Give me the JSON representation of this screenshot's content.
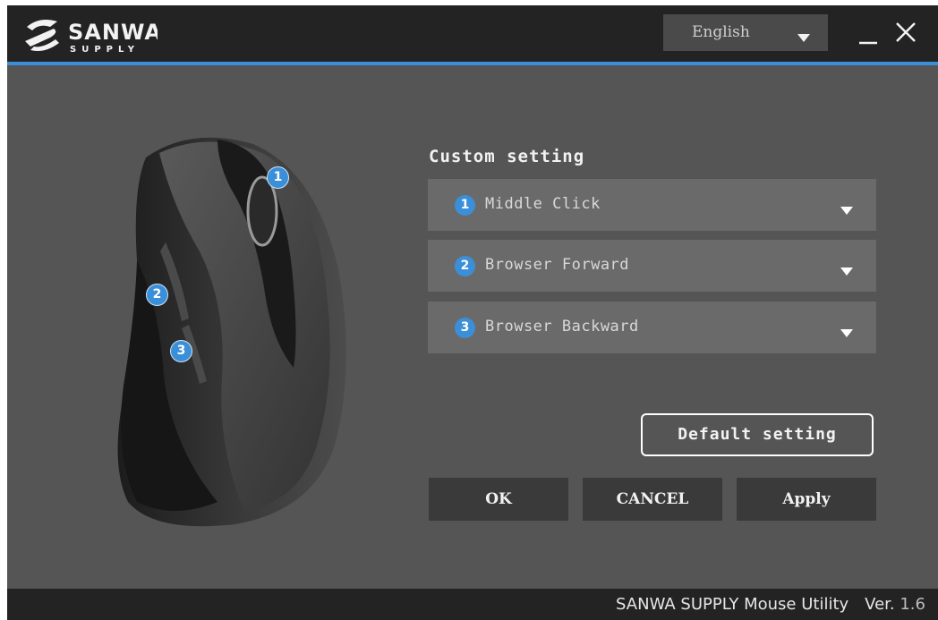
{
  "brand": {
    "logo_line1": "SANWA",
    "logo_line2": "SUPPLY"
  },
  "header": {
    "language": "English",
    "colors": {
      "titlebar": "#232323",
      "accent": "#3b8fd9"
    }
  },
  "main": {
    "section_title": "Custom setting",
    "buttons": [
      {
        "number": "1",
        "action": "Middle Click"
      },
      {
        "number": "2",
        "action": "Browser Forward"
      },
      {
        "number": "3",
        "action": "Browser Backward"
      }
    ],
    "default_label": "Default setting",
    "ok_label": "OK",
    "cancel_label": "CANCEL",
    "apply_label": "Apply"
  },
  "mouse_callouts": [
    "1",
    "2",
    "3"
  ],
  "footer": {
    "app_name": "SANWA SUPPLY Mouse Utility",
    "version_label": "Ver.",
    "version_num": "1.6"
  }
}
